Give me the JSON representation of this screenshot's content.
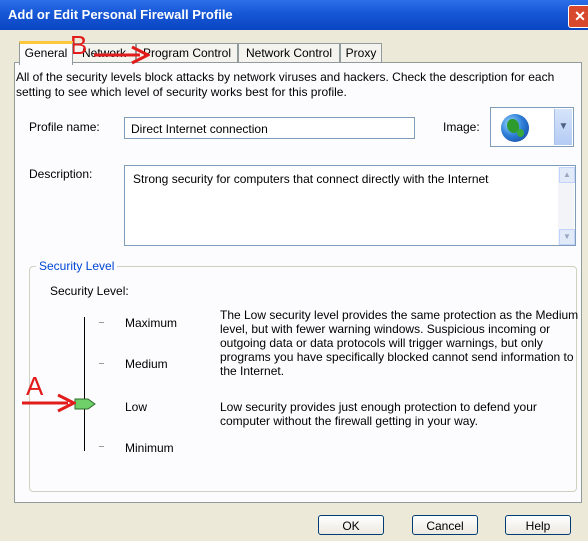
{
  "window": {
    "title": "Add or Edit Personal Firewall Profile"
  },
  "tabs": [
    {
      "label": "General"
    },
    {
      "label": "Network"
    },
    {
      "label": "Program Control"
    },
    {
      "label": "Network Control"
    },
    {
      "label": "Proxy"
    }
  ],
  "intro": "All of the security levels block attacks by network viruses and hackers. Check the description for each setting to see which level of security works best for this profile.",
  "profile": {
    "name_label": "Profile name:",
    "name_value": "Direct Internet connection",
    "image_label": "Image:",
    "image_icon": "globe-icon",
    "description_label": "Description:",
    "description_value": "Strong security for computers that connect directly with the Internet"
  },
  "security": {
    "group_title": "Security Level",
    "level_label": "Security Level:",
    "levels": [
      "Maximum",
      "Medium",
      "Low",
      "Minimum"
    ],
    "selected": "Low",
    "selected_index": 2,
    "desc_1": "The Low security level provides the same protection as the Medium level, but with fewer warning windows. Suspicious incoming or outgoing data or data protocols will trigger warnings, but only programs you have specifically blocked cannot send information to the Internet.",
    "desc_2": "Low security provides just enough protection to defend your computer without the firewall getting in your way."
  },
  "buttons": {
    "ok": "OK",
    "cancel": "Cancel",
    "help": "Help"
  },
  "annotations": {
    "a": "A",
    "b": "B",
    "color": "#e21b1b"
  }
}
